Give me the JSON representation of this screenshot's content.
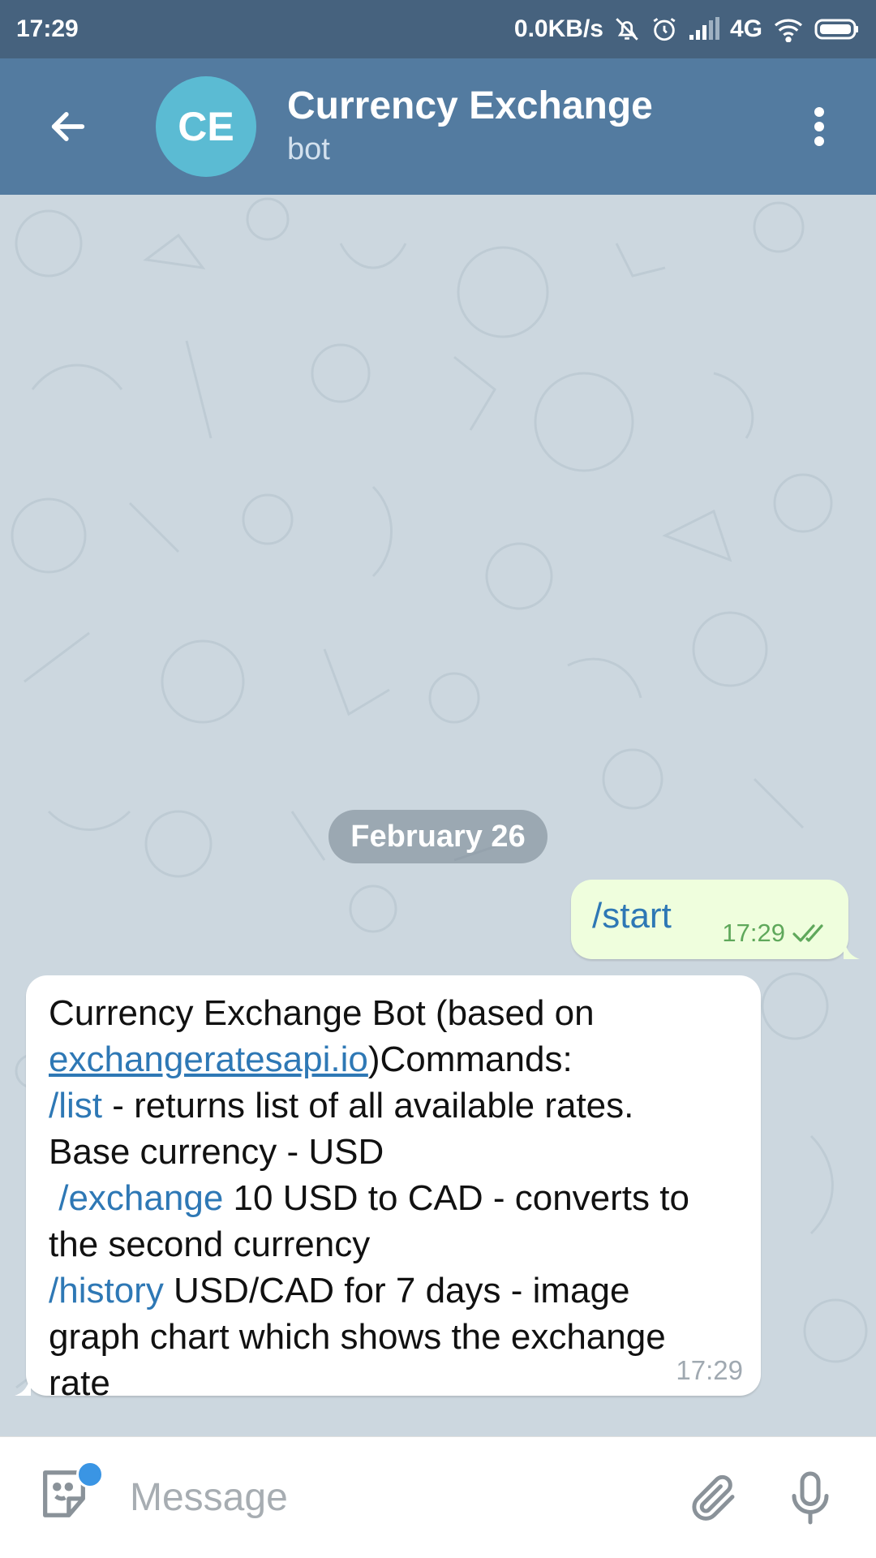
{
  "status_bar": {
    "time": "17:29",
    "network_speed": "0.0KB/s",
    "network_type": "4G"
  },
  "header": {
    "back_icon": "arrow-left-icon",
    "avatar_initials": "CE",
    "avatar_color": "#5bbbd3",
    "title": "Currency Exchange",
    "subtitle": "bot",
    "menu_icon": "more-vertical-icon"
  },
  "chat": {
    "date_separator": "February 26",
    "messages": [
      {
        "direction": "outgoing",
        "text": "/start",
        "time": "17:29",
        "status": "read"
      },
      {
        "direction": "incoming",
        "segments": {
          "intro": "Currency Exchange Bot (based on",
          "site_link": "exchangeratesapi.io",
          "commands_header": ")Commands:",
          "cmd_list": "/list",
          "cmd_list_desc": " - returns list of all available rates.",
          "base_currency": "Base currency - USD",
          "cmd_exchange": "/exchange",
          "cmd_exchange_desc": " 10 USD to CAD - converts to",
          "cmd_exchange_desc2": "the second currency",
          "cmd_history": "/history",
          "cmd_history_desc": " USD/CAD for 7 days - image",
          "cmd_history_desc2": "graph chart which shows the exchange",
          "cmd_history_desc3": "rate"
        },
        "time": "17:29"
      }
    ]
  },
  "input_bar": {
    "placeholder": "Message",
    "sticker_icon": "sticker-icon",
    "attach_icon": "paperclip-icon",
    "mic_icon": "microphone-icon"
  },
  "colors": {
    "header_bg": "#537ba0",
    "status_bg": "#46627e",
    "outgoing_bubble": "#effedd",
    "link": "#2e78b5"
  }
}
